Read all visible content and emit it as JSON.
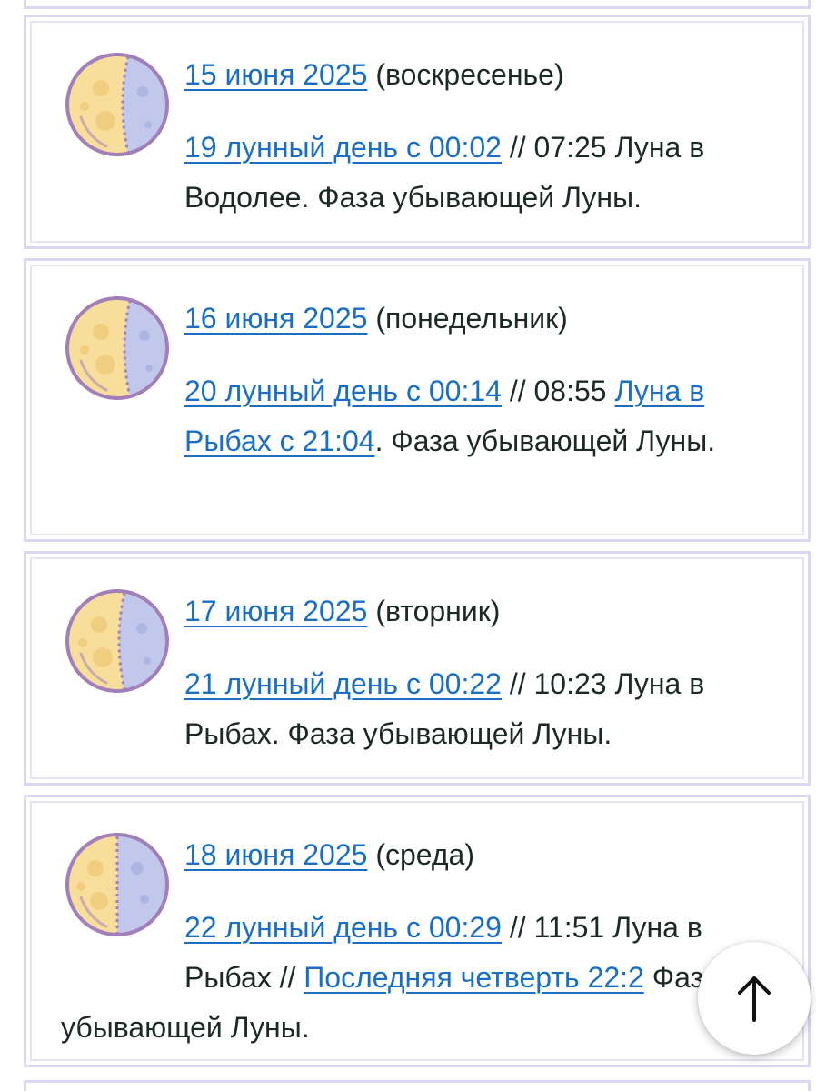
{
  "days": [
    {
      "date_link": "15 июня 2025",
      "weekday": " (воскресенье)",
      "lunar_day_link": "19 лунный день с 00:02",
      "rest_1": " // 07:25 Луна в Водолее. Фаза убывающей Луны.",
      "moon_icon": "waning-moon-icon"
    },
    {
      "date_link": "16 июня 2025",
      "weekday": " (понедельник)",
      "lunar_day_link": "20 лунный день с 00:14",
      "rest_1": " // 08:55 ",
      "sign_link": "Луна в Рыбах с 21:04",
      "rest_2": ". Фаза убывающей Луны.",
      "moon_icon": "waning-moon-icon"
    },
    {
      "date_link": "17 июня 2025",
      "weekday": " (вторник)",
      "lunar_day_link": "21 лунный день с 00:22",
      "rest_1": " // 10:23 Луна в Рыбах. Фаза убывающей Луны.",
      "moon_icon": "waning-moon-icon"
    },
    {
      "date_link": "18 июня 2025",
      "weekday": " (среда)",
      "lunar_day_link": "22 лунный день с 00:29",
      "rest_1": " // 11:51 Луна в Рыбах // ",
      "phase_link": "Последняя четверть 22:2",
      "rest_2": " Фаза убывающей Луны.",
      "moon_icon": "last-quarter-moon-icon"
    }
  ],
  "scroll_top_icon": "arrow-up-icon",
  "colors": {
    "link": "#1a6fc4",
    "text": "#1c2a26",
    "card_border": "#dcd8f1",
    "moon_lit": "#f7df9b",
    "moon_dark": "#c2c8ec",
    "moon_outline": "#a27fb8"
  }
}
